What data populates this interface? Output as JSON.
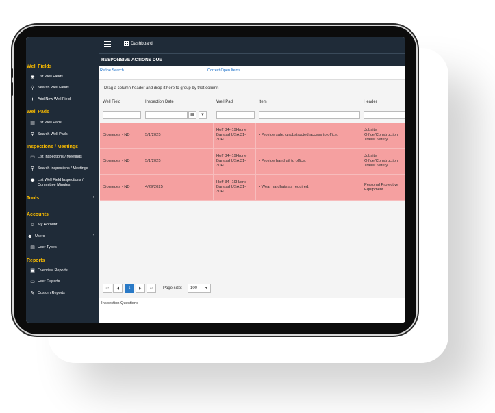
{
  "topbar": {
    "dashboard_label": "Dashboard"
  },
  "sidebar": {
    "sections": [
      {
        "title": "Well Fields",
        "items": [
          {
            "label": "List Well Fields",
            "icon": "globe-icon"
          },
          {
            "label": "Search Well Fields",
            "icon": "search-icon"
          },
          {
            "label": "Add New Well Field",
            "icon": "plus-icon"
          }
        ]
      },
      {
        "title": "Well Pads",
        "items": [
          {
            "label": "List Well Pads",
            "icon": "list-icon"
          },
          {
            "label": "Search Well Pads",
            "icon": "search-icon"
          }
        ]
      },
      {
        "title": "Inspections / Meetings",
        "items": [
          {
            "label": "List Inspections / Meetings",
            "icon": "inbox-icon"
          },
          {
            "label": "Search Inspections / Meetings",
            "icon": "search-icon"
          },
          {
            "label": "List Well Field Inspections /",
            "label2": "Committee Minutes",
            "icon": "globe-icon"
          }
        ]
      },
      {
        "title": "Tools",
        "items": []
      },
      {
        "title": "Accounts",
        "items": [
          {
            "label": "My Account",
            "icon": "user-icon"
          },
          {
            "label": "Users",
            "icon": "users-icon"
          },
          {
            "label": "User Types",
            "icon": "list-icon"
          }
        ]
      },
      {
        "title": "Reports",
        "items": [
          {
            "label": "Overview Reports",
            "icon": "report-icon"
          },
          {
            "label": "User Reports",
            "icon": "inbox-icon"
          },
          {
            "label": "Custom Reports",
            "icon": "edit-icon"
          }
        ]
      }
    ]
  },
  "main": {
    "title": "RESPONSIVE ACTIONS DUE",
    "refine_search": "Refine Search",
    "correct_open_items": "Correct Open Items",
    "group_hint": "Drag a column header and drop it here to group by that column",
    "columns": [
      "Well Field",
      "Inspection Date",
      "Well Pad",
      "Item",
      "Header"
    ],
    "rows": [
      {
        "well_field": "Diomedes - ND",
        "date": "5/1/2025",
        "pad_1": "Hoff 34--19H/one",
        "pad_2": "Barstad USA 31-",
        "pad_3": "30H",
        "item": "• Provide safe, unobstructed access to office.",
        "header_1": "Jobsite",
        "header_2": "Office/Construction",
        "header_3": "Trailer Safety"
      },
      {
        "well_field": "Diomedes - ND",
        "date": "5/1/2025",
        "pad_1": "Hoff 34--19H/one",
        "pad_2": "Barstad USA 31-",
        "pad_3": "30H",
        "item": "• Provide handrail to office.",
        "header_1": "Jobsite",
        "header_2": "Office/Construction",
        "header_3": "Trailer Safety"
      },
      {
        "well_field": "Diomedes - ND",
        "date": "4/29/2025",
        "pad_1": "Hoff 34--19H/one",
        "pad_2": "Barstad USA 31-",
        "pad_3": "30H",
        "item": "• Wear hardhats as required.",
        "header_1": "Personal Protective",
        "header_2": "Equipment",
        "header_3": ""
      }
    ],
    "pager": {
      "first": "⏮",
      "prev": "◀",
      "page": "1",
      "next": "▶",
      "last": "⏭",
      "page_size_label": "Page size:",
      "page_size": "100"
    },
    "inspection_questions": "Inspection Questions"
  },
  "colors": {
    "sidebar_bg": "#1f2b38",
    "section_title": "#f5b800",
    "row_highlight": "#f5a0a0",
    "link": "#1a6fc8",
    "active_page": "#2a7ac7"
  }
}
